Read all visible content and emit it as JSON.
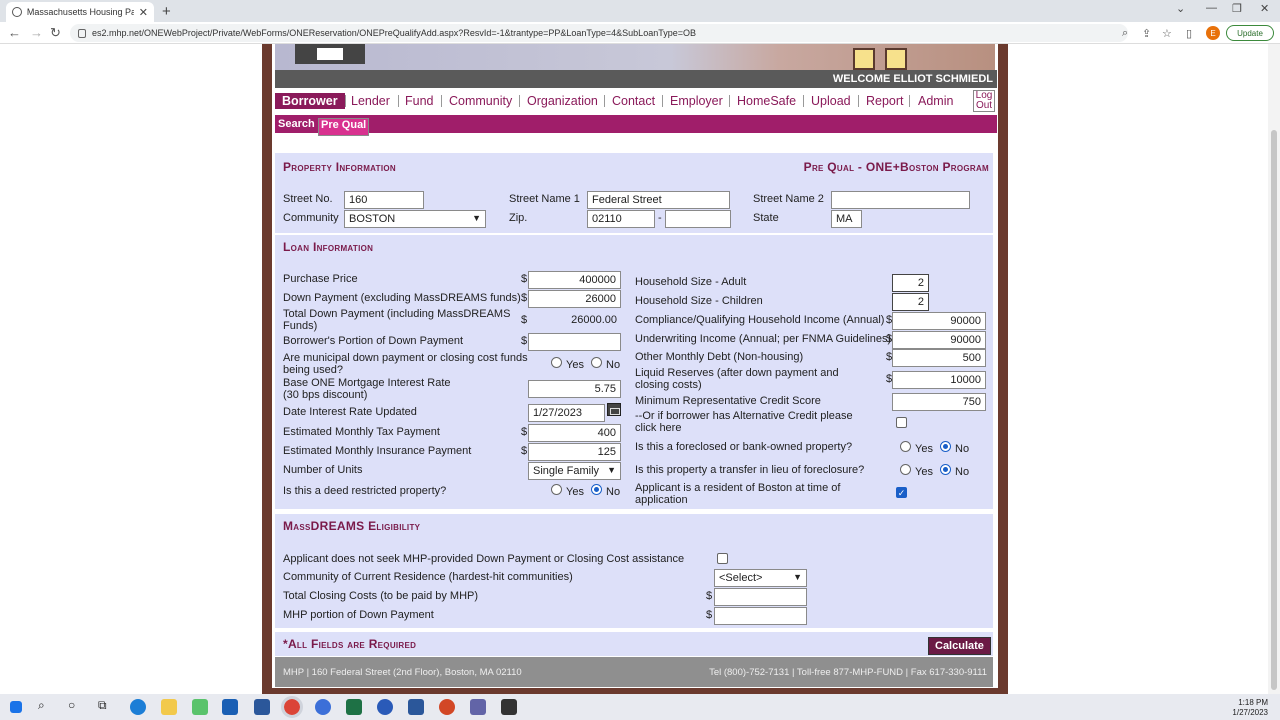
{
  "browser": {
    "tab_title": "Massachusetts Housing Partnersh",
    "tab_close": "✕",
    "new_tab": "+",
    "url": "es2.mhp.net/ONEWebProject/Private/WebForms/ONEReservation/ONEPreQualifyAdd.aspx?ResvId=-1&trantype=PP&LoanType=4&SubLoanType=OB",
    "update_label": "Update",
    "profile_initial": "E"
  },
  "header": {
    "welcome": "WELCOME ELLIOT SCHMIEDL"
  },
  "menu": {
    "items": [
      "Borrower",
      "Lender",
      "Fund",
      "Community",
      "Organization",
      "Contact",
      "Employer",
      "HomeSafe",
      "Upload",
      "Report",
      "Admin"
    ],
    "logout": "Log Out"
  },
  "submenu": {
    "search": "Search",
    "prequal": "Pre Qual"
  },
  "property": {
    "heading": "Property Information",
    "program": "Pre Qual - ONE+Boston Program",
    "street_no_label": "Street No.",
    "street_no": "160",
    "street1_label": "Street Name 1",
    "street1": "Federal Street",
    "street2_label": "Street Name 2",
    "street2": "",
    "community_label": "Community",
    "community": "BOSTON",
    "zip_label": "Zip.",
    "zip": "02110",
    "zip_dash": "-",
    "zip4": "",
    "state_label": "State",
    "state": "MA"
  },
  "loan": {
    "heading": "Loan Information",
    "dollar": "$",
    "purchase_price_label": "Purchase Price",
    "purchase_price": "400000",
    "down_payment_label": "Down Payment (excluding MassDREAMS funds)",
    "down_payment": "26000",
    "total_down_label": "Total Down Payment (including MassDREAMS Funds)",
    "total_down": "26000.00",
    "borrower_portion_label": "Borrower's Portion of Down Payment",
    "borrower_portion": "",
    "municipal_label": "Are municipal down payment or closing cost funds being used?",
    "yes": "Yes",
    "no": "No",
    "rate_label": "Base ONE Mortgage Interest Rate (30 bps discount)",
    "rate": "5.75",
    "rate_date_label": "Date Interest Rate Updated",
    "rate_date": "1/27/2023",
    "tax_label": "Estimated Monthly Tax Payment",
    "tax": "400",
    "insurance_label": "Estimated Monthly Insurance Payment",
    "insurance": "125",
    "units_label": "Number of Units",
    "units": "Single Family",
    "deed_label": "Is this a deed restricted property?",
    "hh_adult_label": "Household Size - Adult",
    "hh_adult": "2",
    "hh_children_label": "Household Size - Children",
    "hh_children": "2",
    "qual_income_label": "Compliance/Qualifying Household Income (Annual)",
    "qual_income": "90000",
    "uw_income_label": "Underwriting Income (Annual; per FNMA Guidelines)",
    "uw_income": "90000",
    "other_debt_label": "Other Monthly Debt (Non-housing)",
    "other_debt": "500",
    "reserves_label": "Liquid Reserves (after down payment and closing costs)",
    "reserves": "10000",
    "credit_label": "Minimum Representative Credit Score",
    "credit": "750",
    "alt_credit_label": "--Or if borrower has Alternative Credit please click here",
    "foreclosed_label": "Is this a foreclosed or bank-owned property?",
    "transfer_label": "Is this property a transfer in lieu of foreclosure?",
    "resident_label": "Applicant is a resident of Boston at time of application"
  },
  "massdreams": {
    "heading": "MassDREAMS Eligibility",
    "no_seek_label": "Applicant does not seek MHP-provided Down Payment or Closing Cost assistance",
    "community_label": "Community of Current Residence (hardest-hit communities)",
    "community_select": "<Select>",
    "closing_label": "Total Closing Costs (to be paid by MHP)",
    "mhp_portion_label": "MHP portion of Down Payment"
  },
  "required": {
    "text": "*All Fields are Required",
    "calculate": "Calculate"
  },
  "footer": {
    "left": "MHP | 160 Federal Street (2nd Floor), Boston, MA 02110",
    "right": "Tel (800)-752-7131 | Toll-free 877-MHP-FUND | Fax 617-330-9111"
  },
  "taskbar": {
    "time": "1:18 PM",
    "date": "1/27/2023"
  }
}
